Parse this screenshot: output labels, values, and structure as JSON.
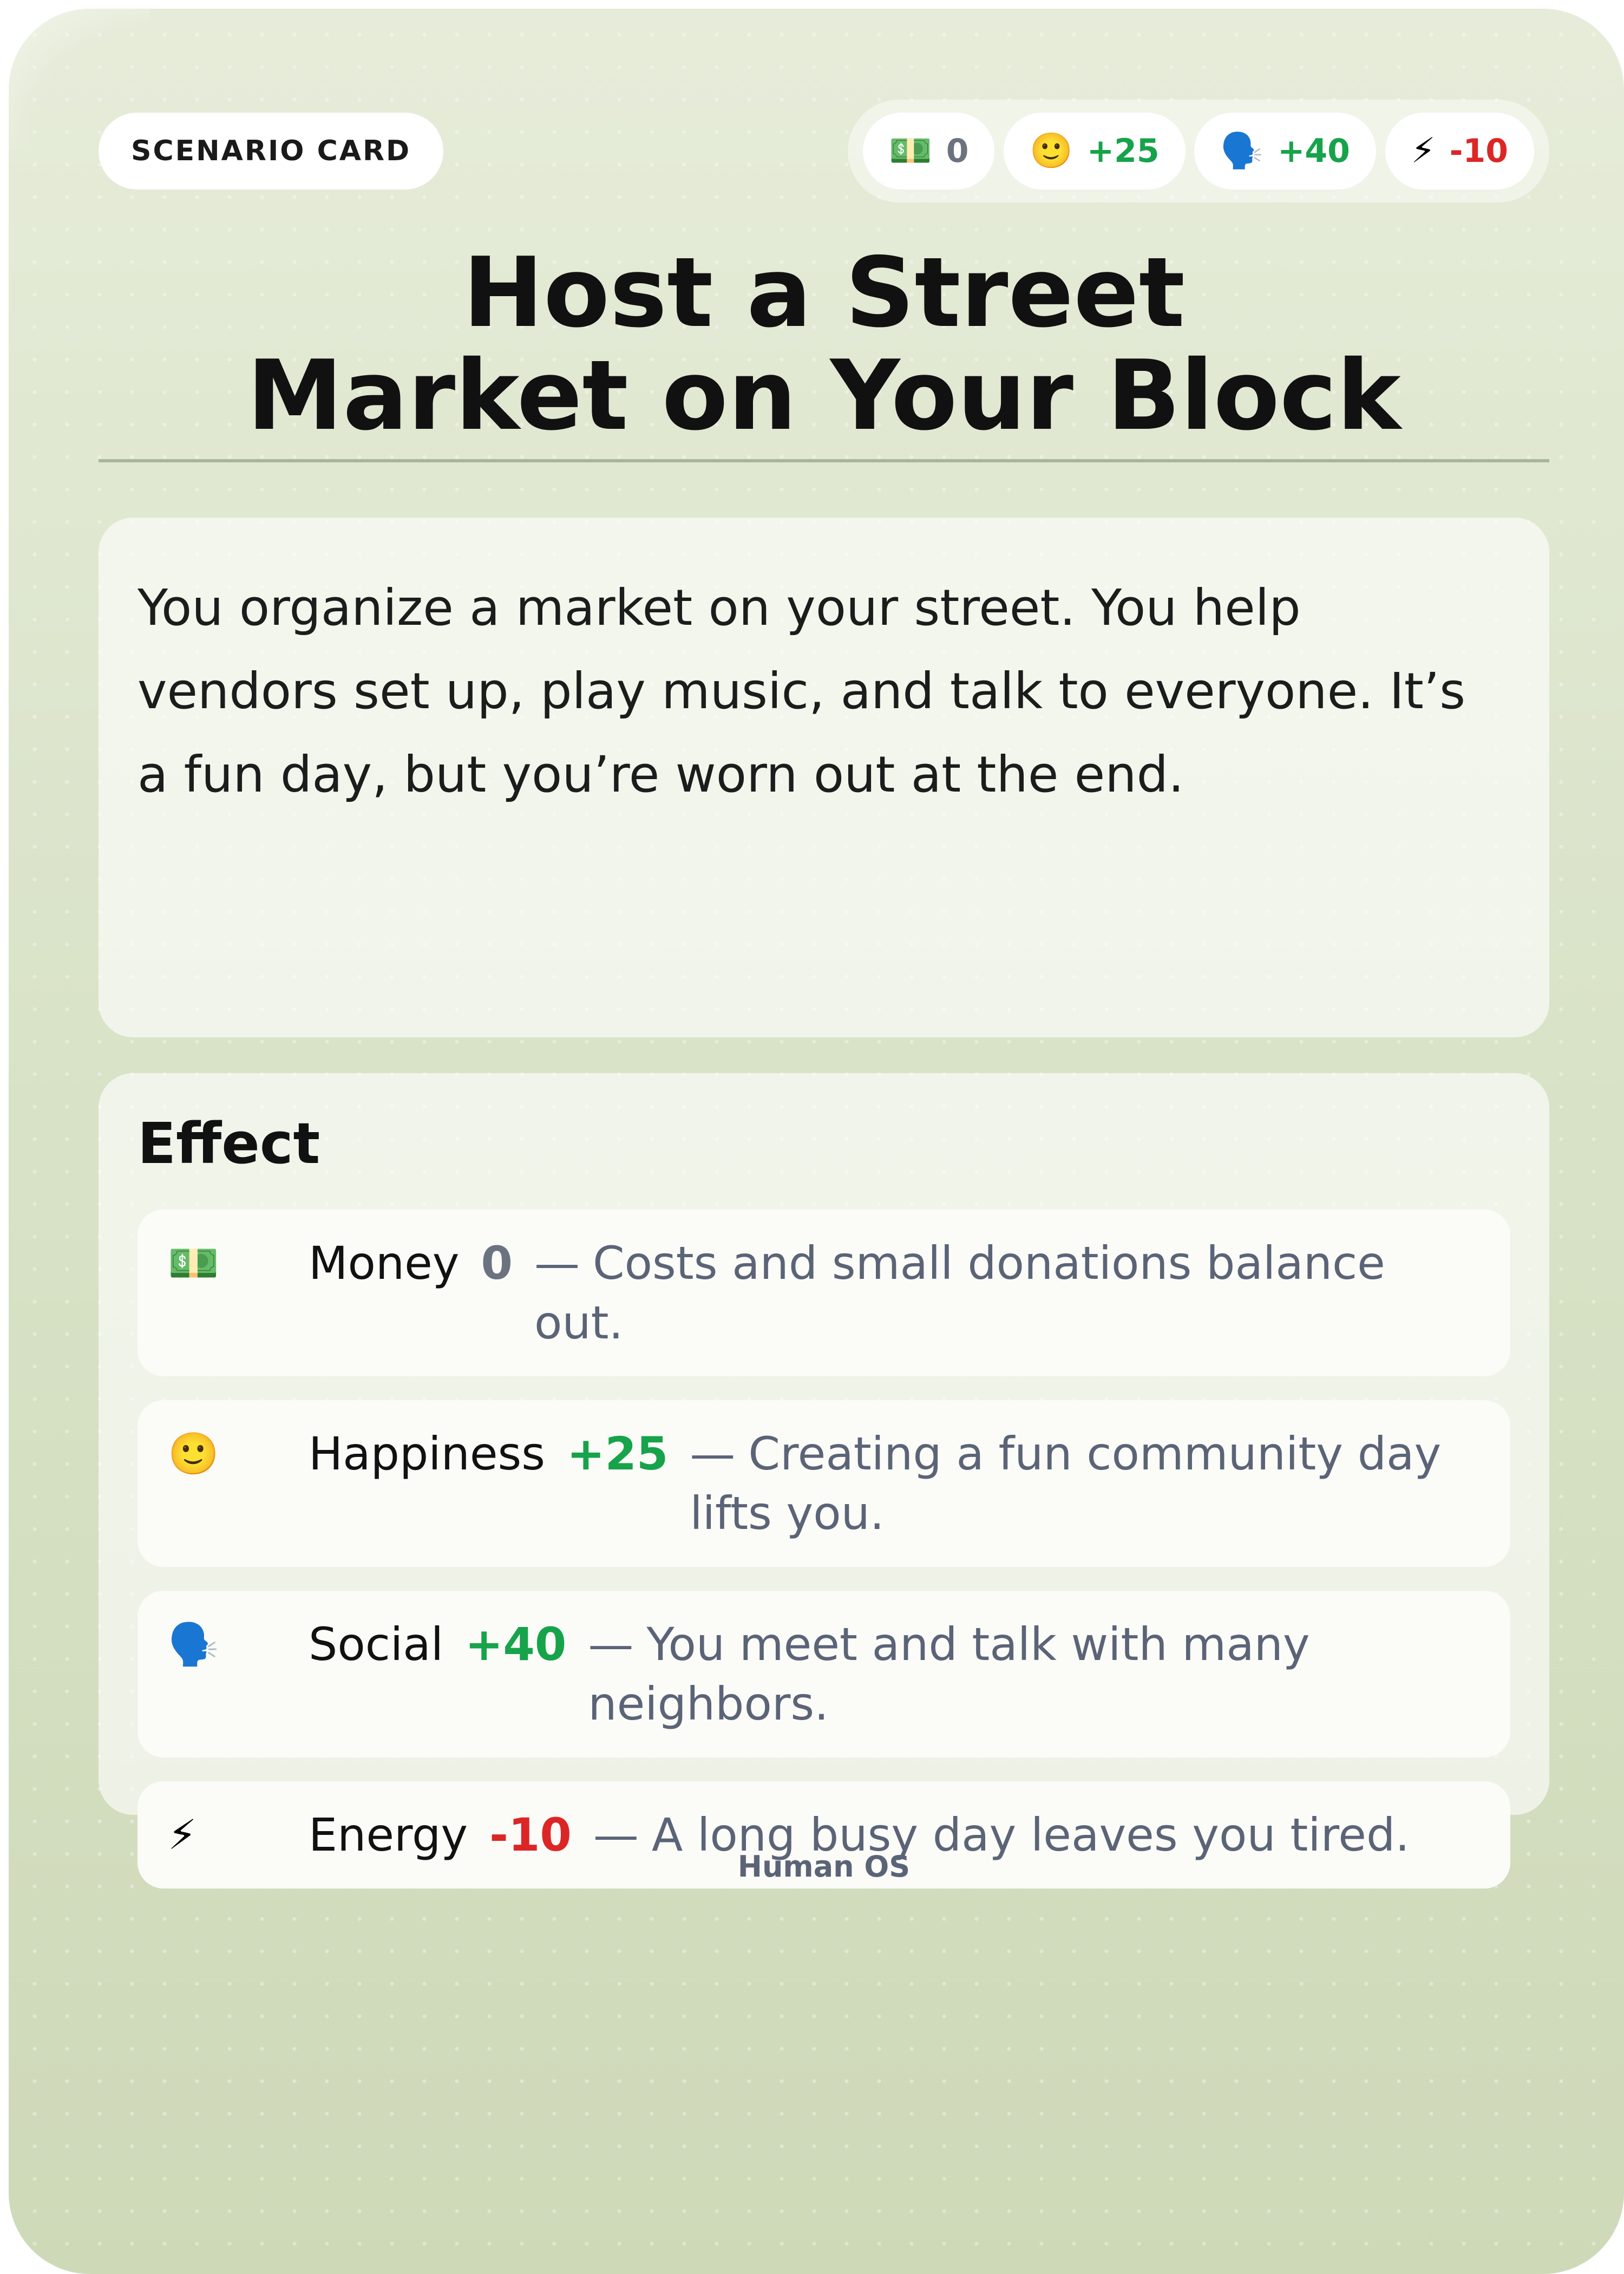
{
  "card": {
    "label": "SCENARIO CARD",
    "title_line1": "Host a Street",
    "title_line2": "Market on Your Block",
    "description": "You organize a market on your street. You help vendors set up, play music, and talk to everyone. It’s a fun day, but you’re worn out at the end.",
    "footer": "Human OS"
  },
  "stats": [
    {
      "icon": "money-icon",
      "glyph": "💵",
      "value": "0",
      "color": "#6b7280"
    },
    {
      "icon": "smiley-icon",
      "glyph": "🙂",
      "value": "+25",
      "color": "#16a34a"
    },
    {
      "icon": "speaking-head-icon",
      "glyph": "🗣️",
      "value": "+40",
      "color": "#16a34a"
    },
    {
      "icon": "lightning-icon",
      "glyph": "⚡",
      "value": "-10",
      "color": "#dc2626"
    }
  ],
  "effect": {
    "heading": "Effect",
    "dash": "—",
    "rows": [
      {
        "icon": "money-icon",
        "glyph": "💵",
        "name": "Money",
        "value": "0",
        "color": "#6b7280",
        "desc": "Costs and small donations balance out."
      },
      {
        "icon": "smiley-icon",
        "glyph": "🙂",
        "name": "Happiness",
        "value": "+25",
        "color": "#16a34a",
        "desc": "Creating a fun community day lifts you."
      },
      {
        "icon": "speaking-head-icon",
        "glyph": "🗣️",
        "name": "Social",
        "value": "+40",
        "color": "#16a34a",
        "desc": "You meet and talk with many neighbors."
      },
      {
        "icon": "lightning-icon",
        "glyph": "⚡",
        "name": "Energy",
        "value": "-10",
        "color": "#dc2626",
        "desc": "A long busy day leaves you tired."
      }
    ]
  }
}
